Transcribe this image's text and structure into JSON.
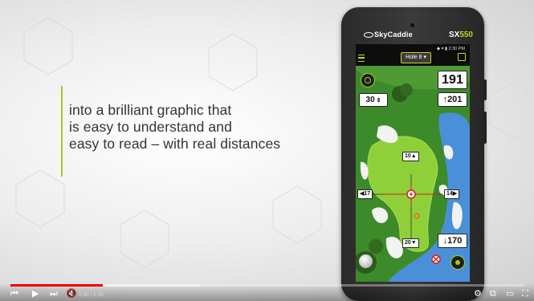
{
  "caption": {
    "lines": [
      "into a brilliant graphic that",
      "is easy to understand and",
      "easy to read – with real distances"
    ]
  },
  "device": {
    "brand_left": "SkyCaddie",
    "brand_model_prefix": "SX",
    "brand_model_number": "550",
    "status_time": "2:30 PM",
    "hole_selector": "Hole 8",
    "distance_center": "191",
    "distance_front": "201",
    "distance_back": "170",
    "layup": "30",
    "target_up": "10",
    "target_left": "17",
    "target_right": "14",
    "target_down": "20"
  },
  "player": {
    "time_display": "0:20 / 1:55",
    "progress_played": 0.18,
    "progress_loaded": 0.37,
    "icons": [
      "skip-back-icon",
      "play-icon",
      "next-icon",
      "mute-icon",
      "settings-icon",
      "miniplayer-icon",
      "theater-icon",
      "fullscreen-icon"
    ]
  },
  "colors": {
    "accent": "#b5bf2a",
    "progress": "#ee0000",
    "fairway": "#8fcf3a",
    "rough": "#3f8a2a",
    "water": "#4a90d9"
  }
}
